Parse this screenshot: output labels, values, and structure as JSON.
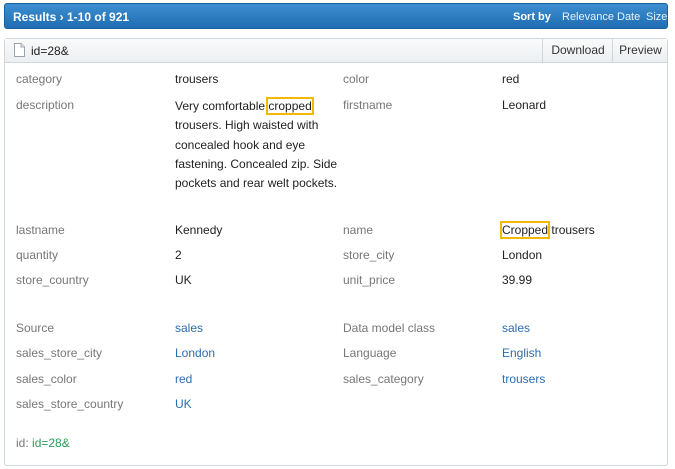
{
  "topbar": {
    "results": "Results › 1-10 of 921",
    "sort_by": "Sort by",
    "sort_options": [
      "Relevance",
      "Date",
      "Size"
    ]
  },
  "doc": {
    "id": "id=28&",
    "buttons": {
      "download": "Download",
      "preview": "Preview"
    },
    "fields": {
      "category": {
        "label": "category",
        "value": "trousers"
      },
      "color": {
        "label": "color",
        "value": "red"
      },
      "description": {
        "label": "description",
        "before": "Very comfortable ",
        "highlight": "cropped",
        "after": " trousers. High waisted with concealed hook and eye fastening. Concealed zip. Side pockets and rear welt pockets."
      },
      "firstname": {
        "label": "firstname",
        "value": "Leonard"
      },
      "lastname": {
        "label": "lastname",
        "value": "Kennedy"
      },
      "name": {
        "label": "name",
        "highlight": "Cropped",
        "after": " trousers"
      },
      "quantity": {
        "label": "quantity",
        "value": "2"
      },
      "store_city": {
        "label": "store_city",
        "value": "London"
      },
      "store_country": {
        "label": "store_country",
        "value": "UK"
      },
      "unit_price": {
        "label": "unit_price",
        "value": "39.99"
      }
    },
    "facets": {
      "source": {
        "label": "Source",
        "value": "sales"
      },
      "data_model_class": {
        "label": "Data model class",
        "value": "sales"
      },
      "sales_store_city": {
        "label": "sales_store_city",
        "value": "London"
      },
      "language": {
        "label": "Language",
        "value": "English"
      },
      "sales_color": {
        "label": "sales_color",
        "value": "red"
      },
      "sales_category": {
        "label": "sales_category",
        "value": "trousers"
      },
      "sales_store_country": {
        "label": "sales_store_country",
        "value": "UK"
      }
    },
    "footer": {
      "label": "id:",
      "value": "id=28&"
    }
  },
  "colors": {
    "topbar": "#2a7cc2",
    "link": "#2a6db0",
    "highlight": "#f3b800",
    "id_value": "#2e9a5a"
  }
}
